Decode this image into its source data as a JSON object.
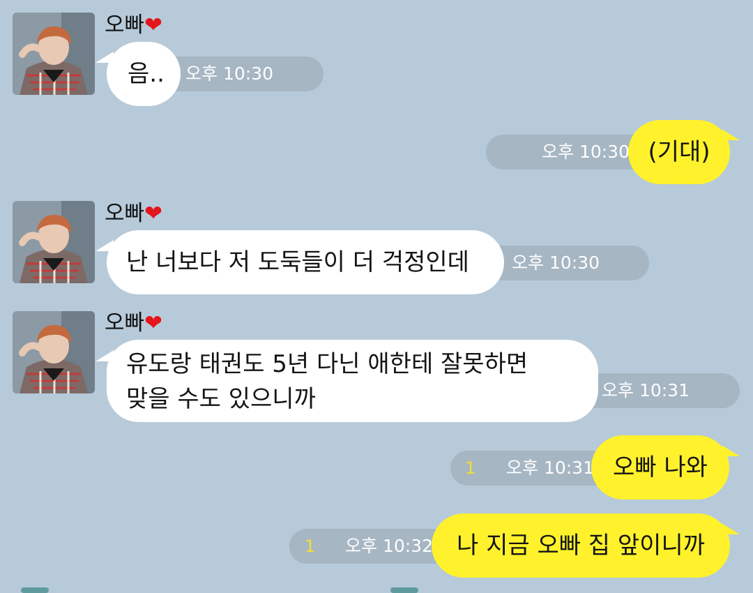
{
  "contact": {
    "name": "오빠",
    "heart_icon": "heart-icon",
    "heart_color": "#e3161c"
  },
  "colors": {
    "background": "#b7cad9",
    "incoming": "#ffffff",
    "outgoing": "#fff22c",
    "pill": "#a6b6c3",
    "unread": "#f4df2a"
  },
  "messages": [
    {
      "dir": "in",
      "text": "음..",
      "time": "오후 10:30"
    },
    {
      "dir": "out",
      "text": "(기대)",
      "time": "오후 10:30"
    },
    {
      "dir": "in",
      "text": "난 너보다 저 도둑들이 더 걱정인데",
      "time": "오후 10:30"
    },
    {
      "dir": "in",
      "lines": [
        "유도랑 태권도 5년 다닌 애한테 잘못하면",
        "맞을 수도 있으니까"
      ],
      "time": "오후 10:31"
    },
    {
      "dir": "out",
      "text": "오빠 나와",
      "time": "오후 10:31",
      "unread": "1"
    },
    {
      "dir": "out",
      "text": "나 지금 오빠 집 앞이니까",
      "time": "오후 10:32",
      "unread": "1"
    }
  ]
}
